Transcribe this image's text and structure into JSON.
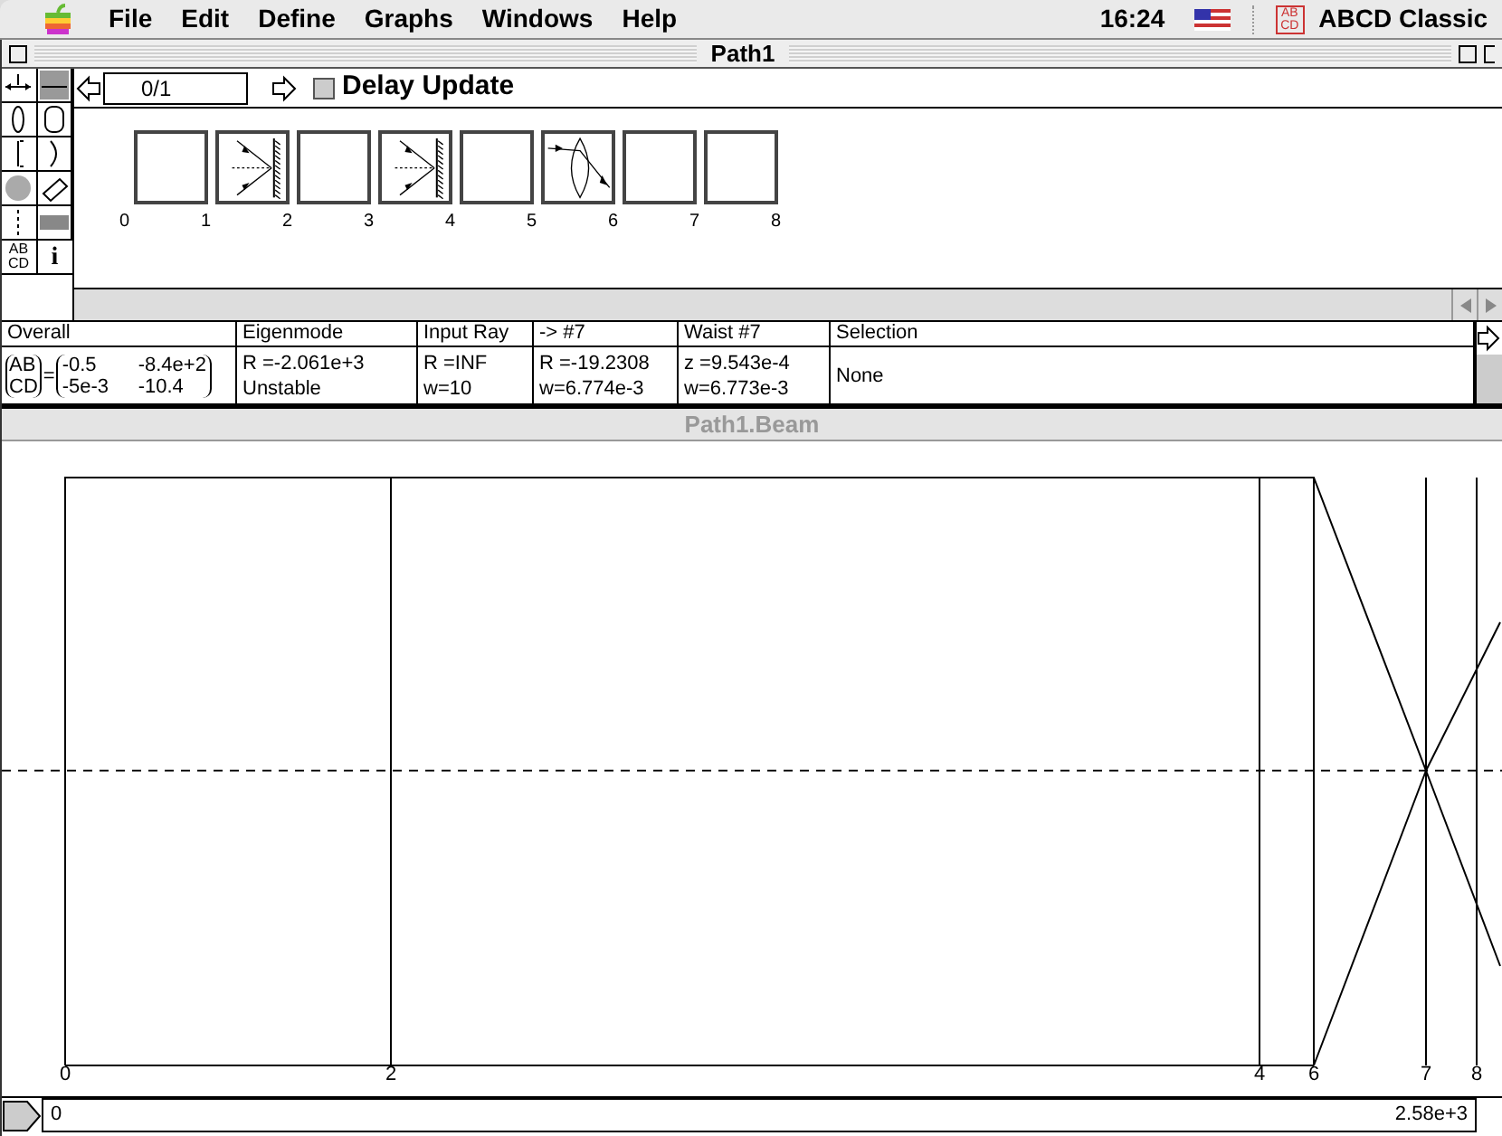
{
  "menu_bar": {
    "items": [
      "File",
      "Edit",
      "Define",
      "Graphs",
      "Windows",
      "Help"
    ],
    "clock": "16:24",
    "app_name": "ABCD Classic",
    "app_icon_text": "AB CD"
  },
  "window": {
    "title": "Path1"
  },
  "toolbar": {
    "counter": "0/1",
    "delay_update": {
      "label": "Delay Update",
      "checked": false
    }
  },
  "palette": {
    "abcd_text": "AB CD",
    "info_text": "i"
  },
  "elements": [
    {
      "kind": "empty"
    },
    {
      "kind": "mirror"
    },
    {
      "kind": "empty"
    },
    {
      "kind": "mirror"
    },
    {
      "kind": "empty"
    },
    {
      "kind": "lens"
    },
    {
      "kind": "empty"
    },
    {
      "kind": "empty"
    }
  ],
  "element_numbers": [
    "0",
    "1",
    "2",
    "3",
    "4",
    "5",
    "6",
    "7",
    "8"
  ],
  "table": {
    "columns": [
      "Overall",
      "Eigenmode",
      "Input Ray",
      "-> #7",
      "Waist #7",
      "Selection"
    ],
    "overall": {
      "labels": [
        "AB",
        "CD"
      ],
      "equals": "=",
      "rows": [
        [
          "-0.5",
          "-8.4e+2"
        ],
        [
          "-5e-3",
          "-10.4"
        ]
      ]
    },
    "cells": [
      [
        "R =-2.061e+3",
        "Unstable"
      ],
      [
        "R =INF",
        "w=10"
      ],
      [
        "R =-19.2308",
        "w=6.774e-3"
      ],
      [
        "z =9.543e-4",
        "w=6.773e-3"
      ],
      [
        "None"
      ]
    ]
  },
  "beam_window": {
    "title": "Path1.Beam"
  },
  "plot": {
    "labels": [
      "0",
      "2",
      "4",
      "6",
      "7",
      "8"
    ]
  },
  "ruler": {
    "start": "0",
    "end": "2.58e+3"
  }
}
